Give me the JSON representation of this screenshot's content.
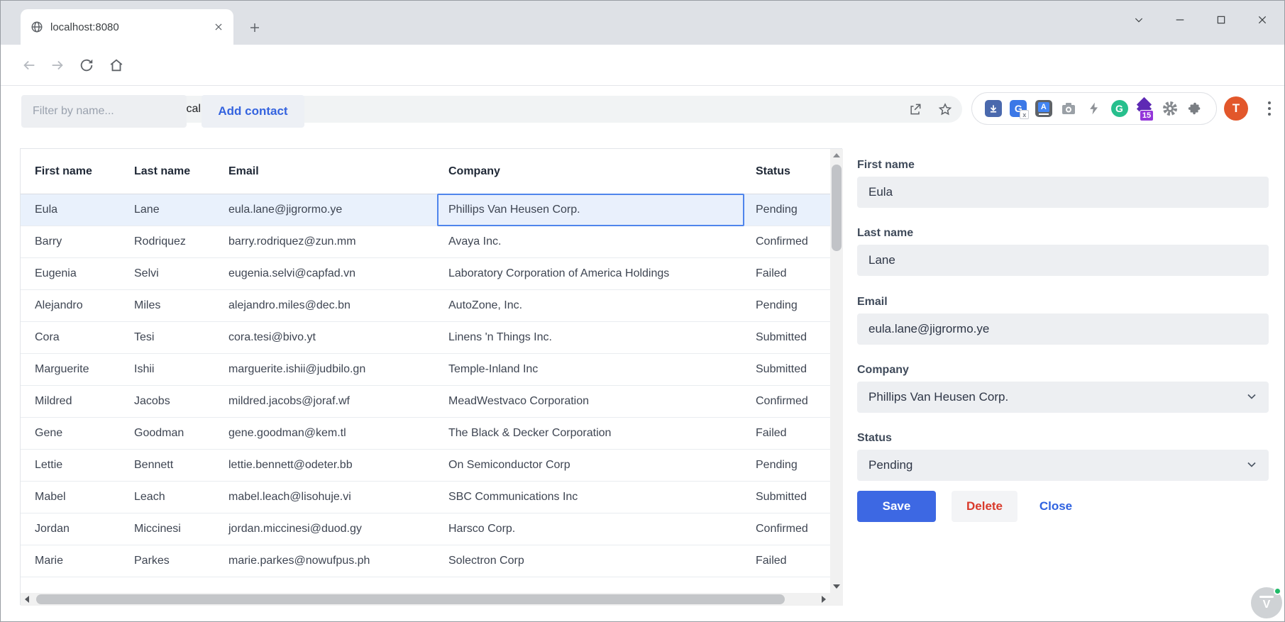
{
  "browser": {
    "tab": {
      "title": "localhost:8080"
    },
    "omnibox": {
      "url": "localhost:8080"
    },
    "extension_badge": "15",
    "profile_initial": "T"
  },
  "page": {
    "filter": {
      "placeholder": "Filter by name..."
    },
    "add_contact_label": "Add contact"
  },
  "grid": {
    "columns": [
      "First name",
      "Last name",
      "Email",
      "Company",
      "Status"
    ],
    "selected_row": 0,
    "focused_cell": "Company",
    "rows": [
      {
        "first": "Eula",
        "last": "Lane",
        "email": "eula.lane@jigrormo.ye",
        "company": "Phillips Van Heusen Corp.",
        "status": "Pending"
      },
      {
        "first": "Barry",
        "last": "Rodriquez",
        "email": "barry.rodriquez@zun.mm",
        "company": "Avaya Inc.",
        "status": "Confirmed"
      },
      {
        "first": "Eugenia",
        "last": "Selvi",
        "email": "eugenia.selvi@capfad.vn",
        "company": "Laboratory Corporation of America Holdings",
        "status": "Failed"
      },
      {
        "first": "Alejandro",
        "last": "Miles",
        "email": "alejandro.miles@dec.bn",
        "company": "AutoZone, Inc.",
        "status": "Pending"
      },
      {
        "first": "Cora",
        "last": "Tesi",
        "email": "cora.tesi@bivo.yt",
        "company": "Linens 'n Things Inc.",
        "status": "Submitted"
      },
      {
        "first": "Marguerite",
        "last": "Ishii",
        "email": "marguerite.ishii@judbilo.gn",
        "company": "Temple-Inland Inc",
        "status": "Submitted"
      },
      {
        "first": "Mildred",
        "last": "Jacobs",
        "email": "mildred.jacobs@joraf.wf",
        "company": "MeadWestvaco Corporation",
        "status": "Confirmed"
      },
      {
        "first": "Gene",
        "last": "Goodman",
        "email": "gene.goodman@kem.tl",
        "company": "The Black & Decker Corporation",
        "status": "Failed"
      },
      {
        "first": "Lettie",
        "last": "Bennett",
        "email": "lettie.bennett@odeter.bb",
        "company": "On Semiconductor Corp",
        "status": "Pending"
      },
      {
        "first": "Mabel",
        "last": "Leach",
        "email": "mabel.leach@lisohuje.vi",
        "company": "SBC Communications Inc",
        "status": "Submitted"
      },
      {
        "first": "Jordan",
        "last": "Miccinesi",
        "email": "jordan.miccinesi@duod.gy",
        "company": "Harsco Corp.",
        "status": "Confirmed"
      },
      {
        "first": "Marie",
        "last": "Parkes",
        "email": "marie.parkes@nowufpus.ph",
        "company": "Solectron Corp",
        "status": "Failed"
      }
    ]
  },
  "form": {
    "first_name": {
      "label": "First name",
      "value": "Eula"
    },
    "last_name": {
      "label": "Last name",
      "value": "Lane"
    },
    "email": {
      "label": "Email",
      "value": "eula.lane@jigrormo.ye"
    },
    "company": {
      "label": "Company",
      "value": "Phillips Van Heusen Corp."
    },
    "status": {
      "label": "Status",
      "value": "Pending"
    },
    "buttons": {
      "save": "Save",
      "delete": "Delete",
      "close": "Close"
    }
  },
  "colors": {
    "accent_blue": "#3d68e3",
    "danger_red": "#d93a2b",
    "selected_row_bg": "#e9f1fc",
    "focus_ring": "#4f85ec",
    "titlebar_bg": "#dee1e6",
    "input_bg": "#edeff2",
    "avatar_orange": "#e2572b",
    "grammarly_green": "#27bf8d",
    "badge_purple": "#9336d9"
  }
}
